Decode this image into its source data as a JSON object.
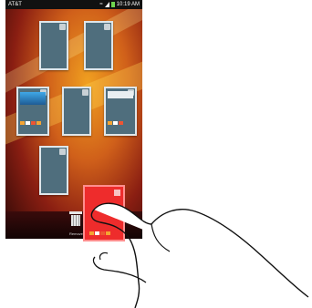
{
  "status_bar": {
    "carrier": "AT&T",
    "time": "10:19 AM",
    "battery_color": "#6fd44f",
    "icons": [
      "signal-icon",
      "wifi-icon",
      "battery-icon"
    ]
  },
  "home_panels": {
    "count": 7,
    "panel_color": "#4f6e7d"
  },
  "dragged_panel": {
    "color": "#ee2c2c",
    "state": "dragging"
  },
  "trash": {
    "label": "Remove",
    "icon": "trash-icon"
  },
  "overlay": {
    "icon": "hand-pointer-icon"
  }
}
